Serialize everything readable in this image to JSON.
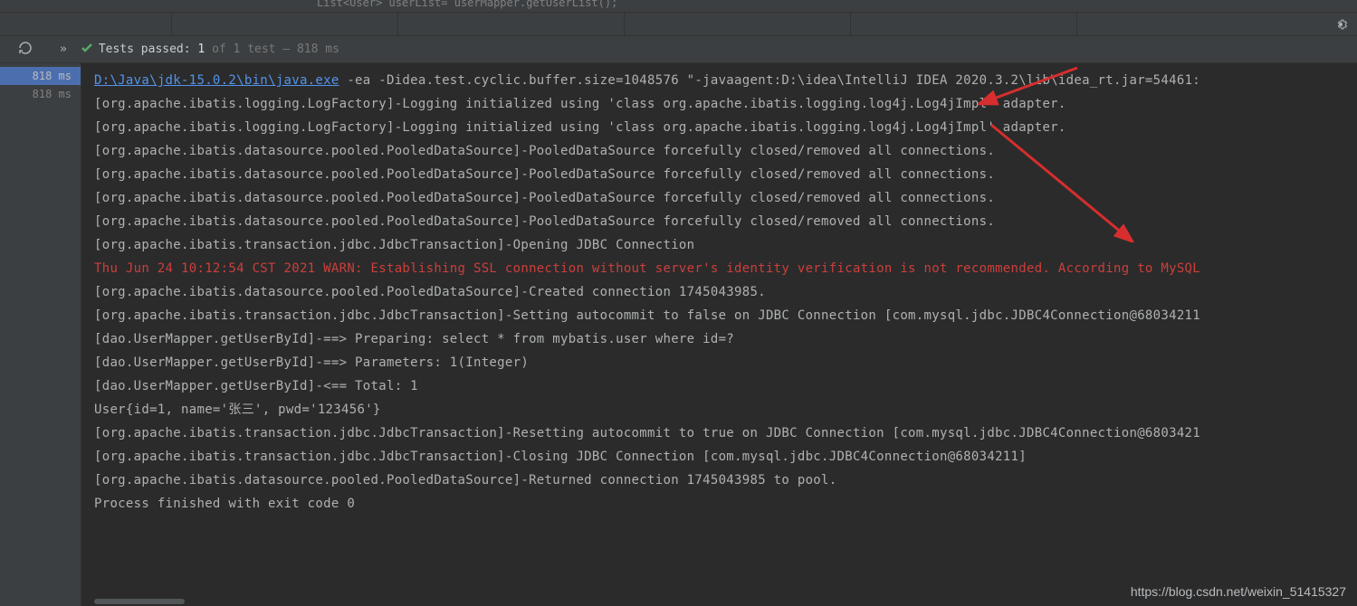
{
  "top_code_fragment": "List<User> userList= userMapper.getUserList();",
  "tests": {
    "passed_label": "Tests passed:",
    "count": "1",
    "rest": " of 1 test – 818 ms"
  },
  "timings": [
    "818 ms",
    "818 ms"
  ],
  "console": {
    "java_path": "D:\\Java\\jdk-15.0.2\\bin\\java.exe",
    "java_args": " -ea -Didea.test.cyclic.buffer.size=1048576 \"-javaagent:D:\\idea\\IntelliJ IDEA 2020.3.2\\lib\\idea_rt.jar=54461:",
    "lines": [
      "[org.apache.ibatis.logging.LogFactory]-Logging initialized using 'class org.apache.ibatis.logging.log4j.Log4jImpl' adapter.",
      "[org.apache.ibatis.logging.LogFactory]-Logging initialized using 'class org.apache.ibatis.logging.log4j.Log4jImpl' adapter.",
      "[org.apache.ibatis.datasource.pooled.PooledDataSource]-PooledDataSource forcefully closed/removed all connections.",
      "[org.apache.ibatis.datasource.pooled.PooledDataSource]-PooledDataSource forcefully closed/removed all connections.",
      "[org.apache.ibatis.datasource.pooled.PooledDataSource]-PooledDataSource forcefully closed/removed all connections.",
      "[org.apache.ibatis.datasource.pooled.PooledDataSource]-PooledDataSource forcefully closed/removed all connections.",
      "[org.apache.ibatis.transaction.jdbc.JdbcTransaction]-Opening JDBC Connection"
    ],
    "warn_line": "Thu Jun 24 10:12:54 CST 2021 WARN: Establishing SSL connection without server's identity verification is not recommended. According to MySQL",
    "lines2": [
      "[org.apache.ibatis.datasource.pooled.PooledDataSource]-Created connection 1745043985.",
      "[org.apache.ibatis.transaction.jdbc.JdbcTransaction]-Setting autocommit to false on JDBC Connection [com.mysql.jdbc.JDBC4Connection@68034211",
      "[dao.UserMapper.getUserById]-==>  Preparing: select * from mybatis.user where id=?",
      "[dao.UserMapper.getUserById]-==> Parameters: 1(Integer)",
      "[dao.UserMapper.getUserById]-<==      Total: 1",
      "User{id=1, name='张三', pwd='123456'}",
      "[org.apache.ibatis.transaction.jdbc.JdbcTransaction]-Resetting autocommit to true on JDBC Connection [com.mysql.jdbc.JDBC4Connection@6803421",
      "[org.apache.ibatis.transaction.jdbc.JdbcTransaction]-Closing JDBC Connection [com.mysql.jdbc.JDBC4Connection@68034211]",
      "[org.apache.ibatis.datasource.pooled.PooledDataSource]-Returned connection 1745043985 to pool.",
      "",
      "Process finished with exit code 0"
    ]
  },
  "watermark": "https://blog.csdn.net/weixin_51415327"
}
